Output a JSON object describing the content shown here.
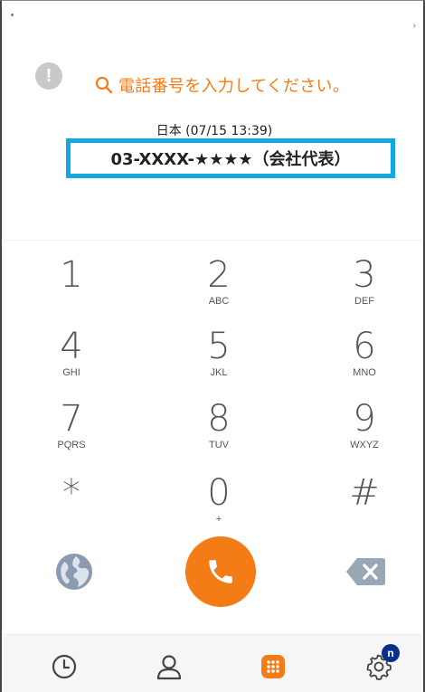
{
  "prompt": {
    "text": "電話番号を入力してください。",
    "icon": "search-icon"
  },
  "alert_icon": {
    "glyph": "!"
  },
  "sub_info": "日本 (07/15 13:39)",
  "phone_number": "03-XXXX-★★★★（会社代表）",
  "keypad": [
    {
      "digit": "1",
      "letters": ""
    },
    {
      "digit": "2",
      "letters": "ABC"
    },
    {
      "digit": "3",
      "letters": "DEF"
    },
    {
      "digit": "4",
      "letters": "GHI"
    },
    {
      "digit": "5",
      "letters": "JKL"
    },
    {
      "digit": "6",
      "letters": "MNO"
    },
    {
      "digit": "7",
      "letters": "PQRS"
    },
    {
      "digit": "8",
      "letters": "TUV"
    },
    {
      "digit": "9",
      "letters": "WXYZ"
    },
    {
      "digit": "*",
      "letters": ""
    },
    {
      "digit": "0",
      "letters": "+"
    },
    {
      "digit": "#",
      "letters": ""
    }
  ],
  "actions": {
    "globe": "globe-icon",
    "call": "phone-icon",
    "backspace": "backspace-icon"
  },
  "nav": {
    "items": [
      "history-icon",
      "contacts-icon",
      "dialpad-icon",
      "settings-icon"
    ],
    "badge": "n"
  },
  "colors": {
    "accent": "#f47c17",
    "highlight_border": "#14a8e0",
    "badge": "#0a2f8c"
  }
}
